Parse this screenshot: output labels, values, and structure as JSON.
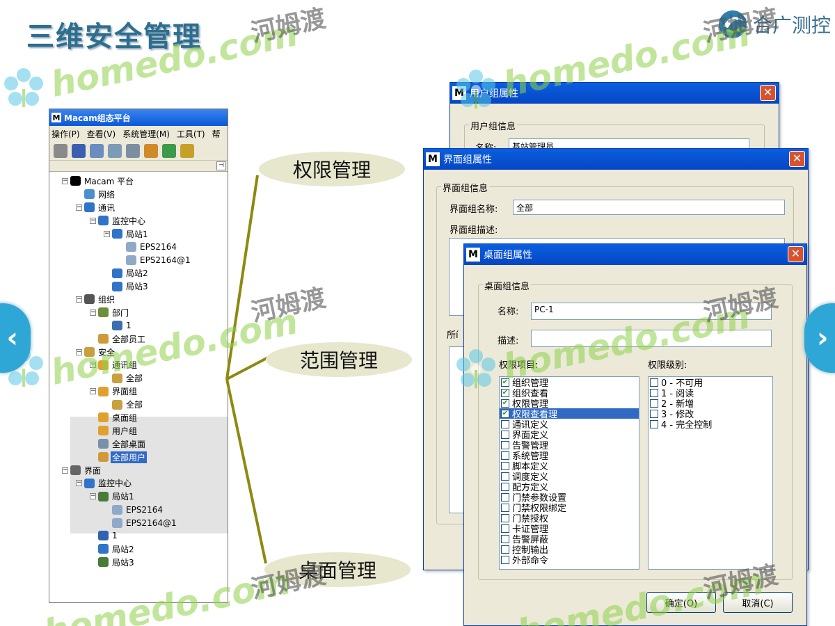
{
  "slide": {
    "title": "三维安全管理",
    "brand": {
      "logo_icon": "brand-swirl-logo",
      "name": "合广测控"
    }
  },
  "watermarks": {
    "site": "homedo.com",
    "cn": "河姆渡"
  },
  "macam_window": {
    "title": "Macam组态平台",
    "menu": [
      "操作(P)",
      "查看(V)",
      "系统管理(M)",
      "工具(T)",
      "帮"
    ],
    "toolbar_icons": [
      "user-icon",
      "book-icon",
      "search-icon",
      "window-icon",
      "grid-icon",
      "hand-icon",
      "refresh-icon",
      "network-icon"
    ],
    "tree": [
      {
        "level": 0,
        "exp": "⊟",
        "label": "Macam 平台",
        "icon": "macam-icon"
      },
      {
        "level": 1,
        "exp": "",
        "label": "网络",
        "icon": "network-icon"
      },
      {
        "level": 1,
        "exp": "⊟",
        "label": "通讯",
        "icon": "globe-icon"
      },
      {
        "level": 2,
        "exp": "⊟",
        "label": "监控中心",
        "icon": "globe-icon"
      },
      {
        "level": 3,
        "exp": "⊟",
        "label": "局站1",
        "icon": "globe-icon"
      },
      {
        "level": 4,
        "exp": "",
        "label": "EPS2164",
        "icon": "device-icon"
      },
      {
        "level": 4,
        "exp": "",
        "label": "EPS2164@1",
        "icon": "device-icon"
      },
      {
        "level": 3,
        "exp": "",
        "label": "局站2",
        "icon": "globe-icon"
      },
      {
        "level": 3,
        "exp": "",
        "label": "局站3",
        "icon": "globe-icon"
      },
      {
        "level": 1,
        "exp": "⊟",
        "label": "组织",
        "icon": "org-icon"
      },
      {
        "level": 2,
        "exp": "⊟",
        "label": "部门",
        "icon": "dept-icon"
      },
      {
        "level": 3,
        "exp": "",
        "label": "1",
        "icon": "card-icon"
      },
      {
        "level": 2,
        "exp": "",
        "label": "全部员工",
        "icon": "users-icon"
      },
      {
        "level": 1,
        "exp": "⊟",
        "label": "安全",
        "icon": "lock-icon"
      },
      {
        "level": 2,
        "exp": "⊟",
        "label": "通讯组",
        "icon": "group-icon"
      },
      {
        "level": 3,
        "exp": "",
        "label": "全部",
        "icon": "key-icon"
      },
      {
        "level": 2,
        "exp": "⊟",
        "label": "界面组",
        "icon": "group-icon"
      },
      {
        "level": 3,
        "exp": "",
        "label": "全部",
        "icon": "key-icon"
      },
      {
        "level": 2,
        "exp": "",
        "label": "桌面组",
        "icon": "group-icon"
      },
      {
        "level": 2,
        "exp": "",
        "label": "用户组",
        "icon": "group-icon"
      },
      {
        "level": 2,
        "exp": "",
        "label": "全部桌面",
        "icon": "desktop-icon"
      },
      {
        "level": 2,
        "exp": "",
        "label": "全部用户",
        "icon": "users-icon",
        "selected": true
      },
      {
        "level": 0,
        "exp": "⊟",
        "label": "界面",
        "icon": "monitor-icon"
      },
      {
        "level": 1,
        "exp": "⊟",
        "label": "监控中心",
        "icon": "globe-icon"
      },
      {
        "level": 2,
        "exp": "⊟",
        "label": "局站1",
        "icon": "station-icon"
      },
      {
        "level": 3,
        "exp": "",
        "label": "EPS2164",
        "icon": "device-icon"
      },
      {
        "level": 3,
        "exp": "",
        "label": "EPS2164@1",
        "icon": "device-icon"
      },
      {
        "level": 2,
        "exp": "",
        "label": "1",
        "icon": "grid-icon"
      },
      {
        "level": 2,
        "exp": "",
        "label": "局站2",
        "icon": "globe-icon"
      },
      {
        "level": 2,
        "exp": "",
        "label": "局站3",
        "icon": "station-icon"
      }
    ]
  },
  "callouts": {
    "permission": "权限管理",
    "scope": "范围管理",
    "desktop": "桌面管理"
  },
  "dialog_user_group": {
    "title": "用户组属性",
    "group_label": "用户组信息",
    "name_label": "名称:",
    "name_value": "基站管理员"
  },
  "dialog_ui_group": {
    "title": "界面组属性",
    "group_label": "界面组信息",
    "name_label": "界面组名称:",
    "name_value": "全部",
    "desc_label": "界面组描述:",
    "partial_label": "所í"
  },
  "dialog_desktop_group": {
    "title": "桌面组属性",
    "group_label": "桌面组信息",
    "name_label": "名称:",
    "name_value": "PC-1",
    "desc_label": "描述:",
    "desc_value": "",
    "items_label": "权限项目:",
    "levels_label": "权限级别:",
    "items": [
      {
        "label": "组织管理",
        "checked": true
      },
      {
        "label": "组织查看",
        "checked": true
      },
      {
        "label": "权限管理",
        "checked": true
      },
      {
        "label": "权限查看理",
        "checked": true,
        "highlight": true
      },
      {
        "label": "通讯定义",
        "checked": false
      },
      {
        "label": "界面定义",
        "checked": false
      },
      {
        "label": "告警管理",
        "checked": false
      },
      {
        "label": "系统管理",
        "checked": false
      },
      {
        "label": "脚本定义",
        "checked": false
      },
      {
        "label": "调度定义",
        "checked": false
      },
      {
        "label": "配方定义",
        "checked": false
      },
      {
        "label": "门禁参数设置",
        "checked": false
      },
      {
        "label": "门禁权限绑定",
        "checked": false
      },
      {
        "label": "门禁授权",
        "checked": false
      },
      {
        "label": "卡证管理",
        "checked": false
      },
      {
        "label": "告警屏蔽",
        "checked": false
      },
      {
        "label": "控制输出",
        "checked": false
      },
      {
        "label": "外部命令",
        "checked": false
      }
    ],
    "levels": [
      {
        "label": "0 - 不可用",
        "checked": false
      },
      {
        "label": "1 - 阅读",
        "checked": false
      },
      {
        "label": "2 - 新增",
        "checked": false
      },
      {
        "label": "3 - 修改",
        "checked": false
      },
      {
        "label": "4 - 完全控制",
        "checked": false
      }
    ],
    "ok_label": "确定(O)",
    "cancel_label": "取消(C)"
  },
  "colors": {
    "titlebar": "#0a58d8",
    "selection": "#316ac5",
    "callout_line": "#8c8a10",
    "callout_fill": "#e7e7ce",
    "title_text": "#2d6e8e"
  }
}
